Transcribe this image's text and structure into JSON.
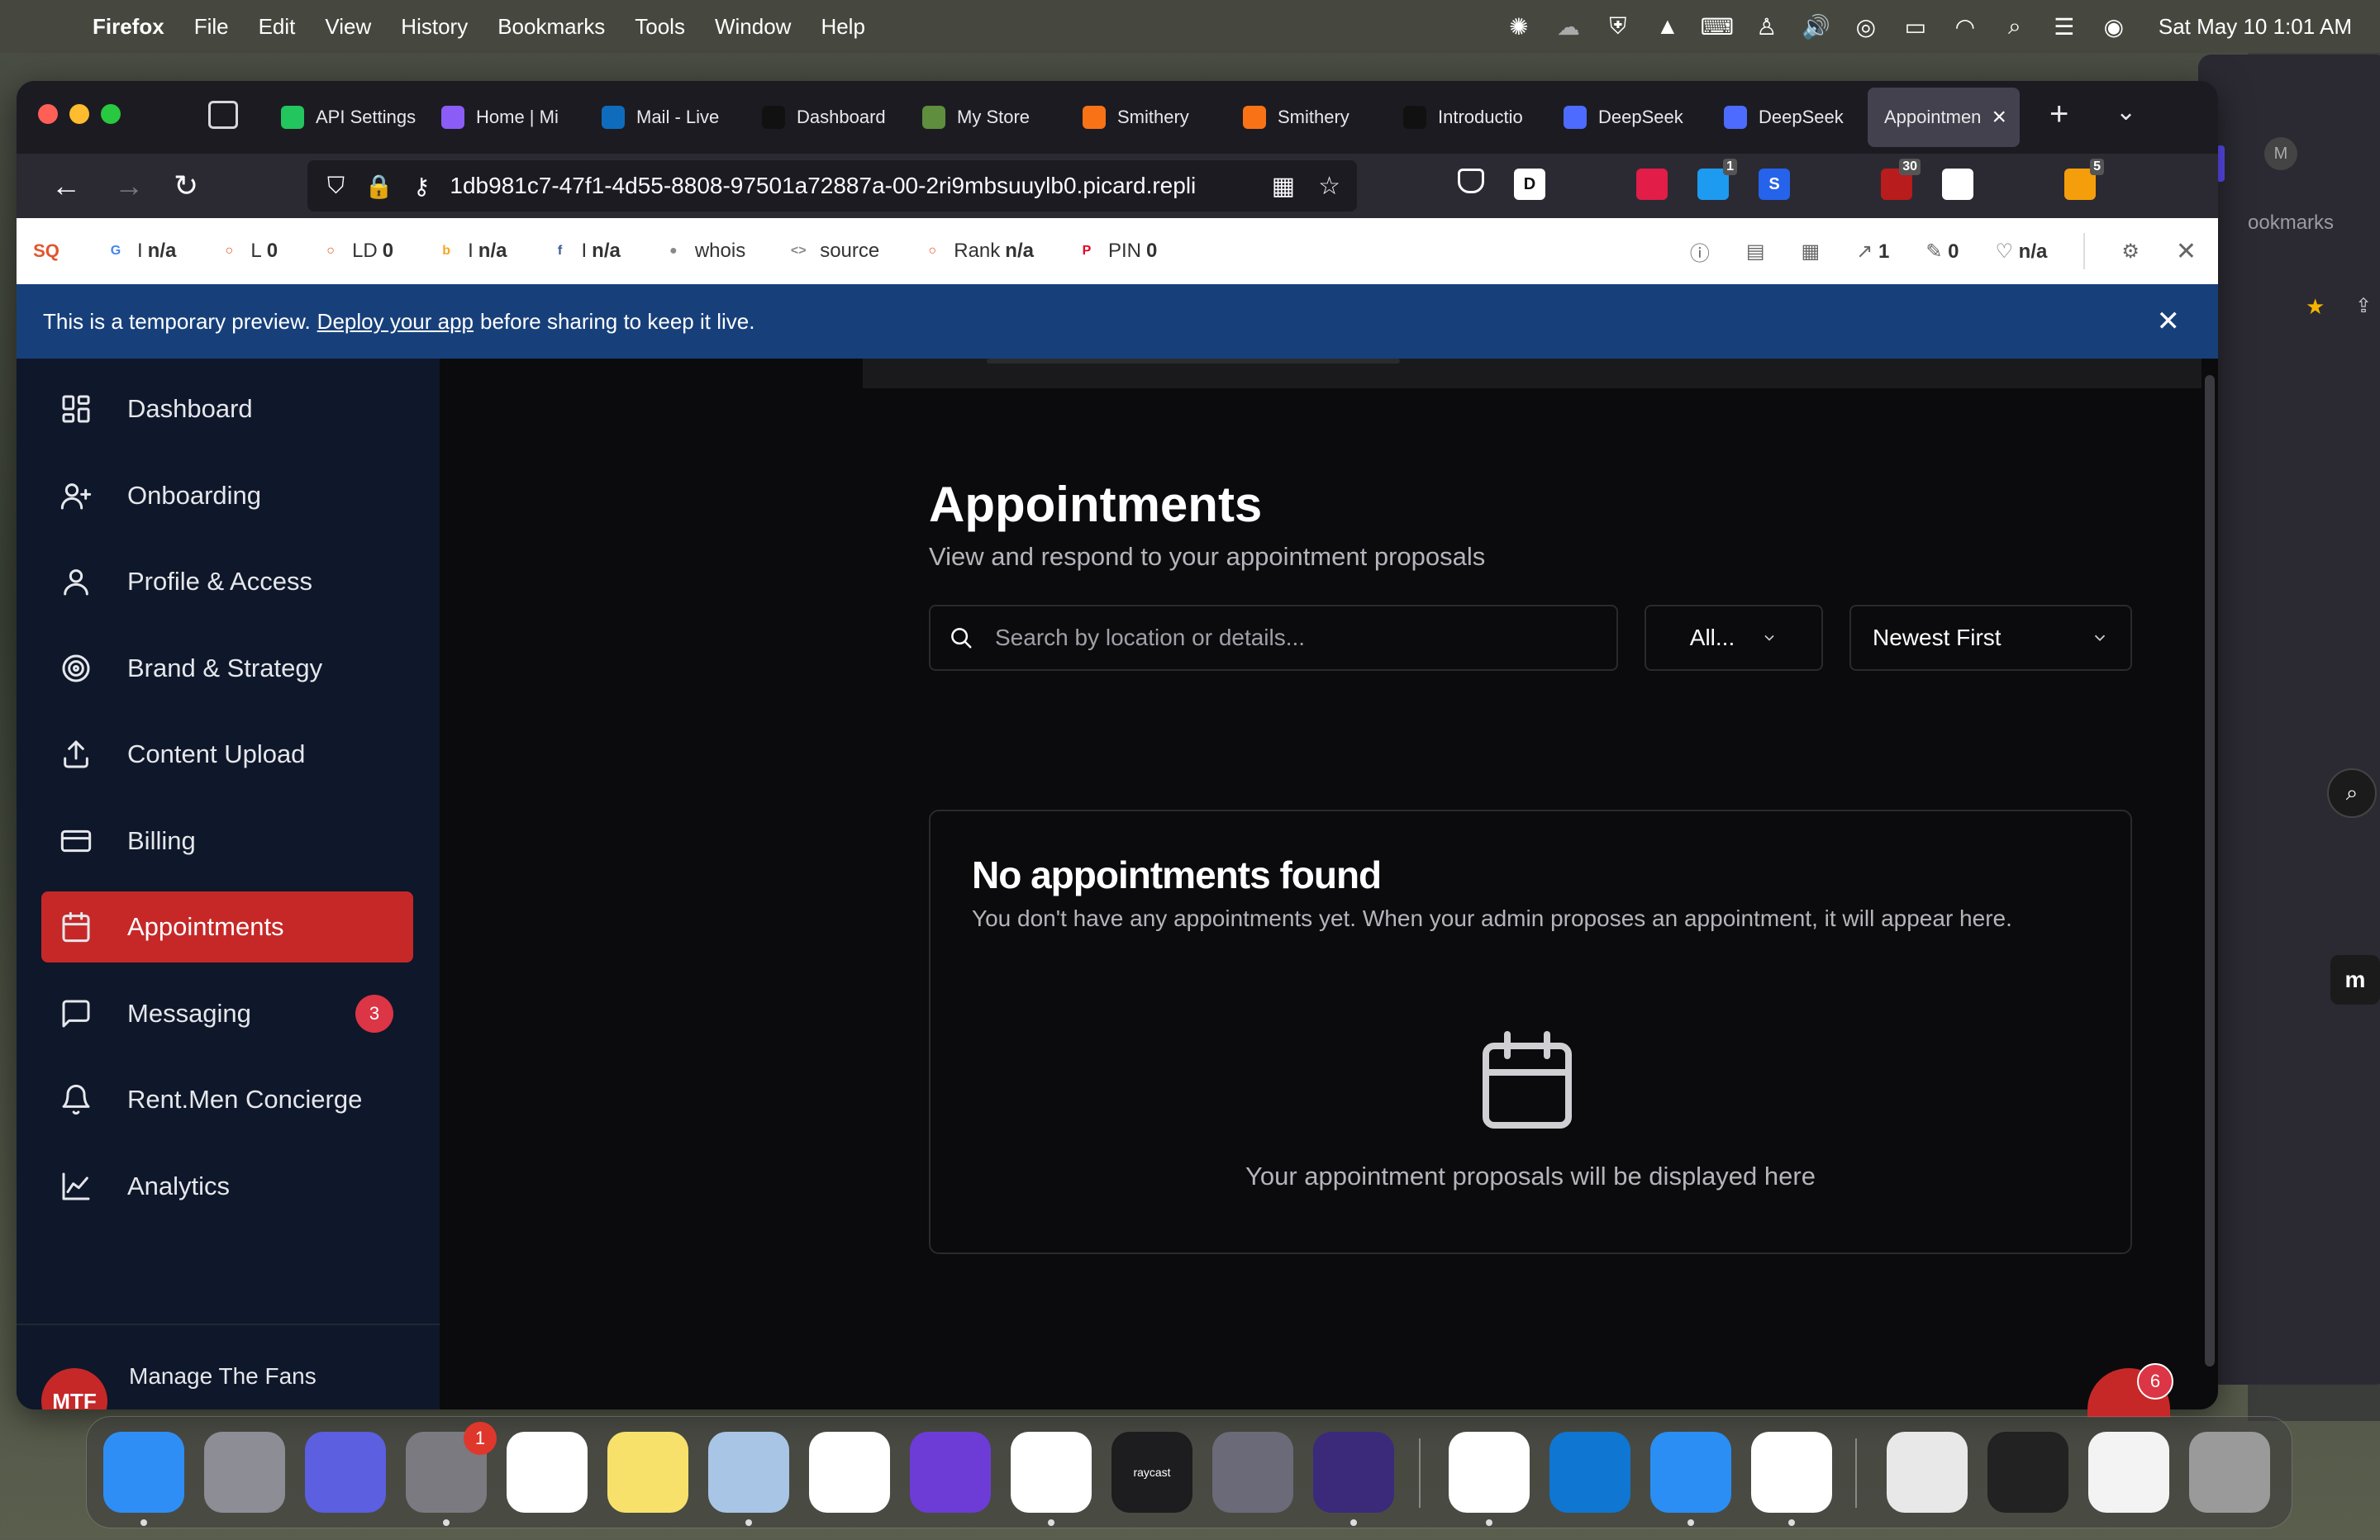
{
  "menubar": {
    "app_name": "Firefox",
    "items": [
      "File",
      "Edit",
      "View",
      "History",
      "Bookmarks",
      "Tools",
      "Window",
      "Help"
    ],
    "clock": "Sat May 10  1:01 AM"
  },
  "tabs": [
    {
      "label": "API Settings",
      "icon_color": "#22c55e",
      "icon": "bolt-icon"
    },
    {
      "label": "Home | Mi",
      "icon_color": "#8b5cf6",
      "icon": "copilot-icon"
    },
    {
      "label": "Mail - Live",
      "icon_color": "#0f6cbd",
      "icon": "outlook-icon"
    },
    {
      "label": "Dashboard",
      "icon_color": "#111111",
      "icon": "chart-icon"
    },
    {
      "label": "My Store",
      "icon_color": "#5e8e3e",
      "icon": "shopify-icon"
    },
    {
      "label": "Smithery",
      "icon_color": "#f97316",
      "icon": "smithery-icon"
    },
    {
      "label": "Smithery",
      "icon_color": "#f97316",
      "icon": "smithery-icon"
    },
    {
      "label": "Introductio",
      "icon_color": "#111111",
      "icon": "diamond-icon"
    },
    {
      "label": "DeepSeek",
      "icon_color": "#4d6bfe",
      "icon": "deepseek-icon"
    },
    {
      "label": "DeepSeek",
      "icon_color": "#4d6bfe",
      "icon": "deepseek-icon"
    },
    {
      "label": "Appointmen",
      "icon_color": "",
      "icon": "",
      "active": true
    }
  ],
  "url": "1db981c7-47f1-4d55-8808-97501a72887a-00-2ri9mbsuuylb0.picard.repli",
  "extensions": [
    {
      "label": "D",
      "color": "#ffffff",
      "text_color": "#111"
    },
    {
      "label": "",
      "color": "transparent"
    },
    {
      "label": "",
      "color": "#e11d48"
    },
    {
      "label": "1",
      "color": "#1d9bf0"
    },
    {
      "label": "S",
      "color": "#2563eb"
    },
    {
      "label": "",
      "color": "transparent"
    },
    {
      "label": "30",
      "color": "#b91c1c"
    },
    {
      "label": "",
      "color": "#ffffff"
    },
    {
      "label": "",
      "color": "transparent"
    },
    {
      "label": "5",
      "color": "#f59e0b"
    }
  ],
  "seobar": {
    "items": [
      {
        "prefix": "I",
        "value": "n/a",
        "icon_color": "#4285f4",
        "icon": "G"
      },
      {
        "prefix": "L",
        "value": "0",
        "icon_color": "#e2552c",
        "icon": "○"
      },
      {
        "prefix": "LD",
        "value": "0",
        "icon_color": "#e2552c",
        "icon": "○"
      },
      {
        "prefix": "I",
        "value": "n/a",
        "icon_color": "#f5a623",
        "icon": "b"
      },
      {
        "prefix": "I",
        "value": "n/a",
        "icon_color": "#3b5998",
        "icon": "f"
      },
      {
        "prefix": "whois",
        "value": "",
        "icon_color": "#888888",
        "icon": "●"
      },
      {
        "prefix": "source",
        "value": "",
        "icon_color": "#888888",
        "icon": "<>"
      },
      {
        "prefix": "Rank",
        "value": "n/a",
        "icon_color": "#e2552c",
        "icon": "○"
      },
      {
        "prefix": "PIN",
        "value": "0",
        "icon_color": "#e60023",
        "icon": "P"
      }
    ],
    "right": {
      "links": "1",
      "edits": "0",
      "score": "n/a"
    }
  },
  "banner": {
    "before": "This is a temporary preview.",
    "link": "Deploy your app",
    "after": "before sharing to keep it live."
  },
  "sidebar": {
    "items": [
      {
        "label": "Dashboard",
        "icon": "dashboard-icon"
      },
      {
        "label": "Onboarding",
        "icon": "user-plus-icon"
      },
      {
        "label": "Profile & Access",
        "icon": "user-icon"
      },
      {
        "label": "Brand & Strategy",
        "icon": "target-icon"
      },
      {
        "label": "Content Upload",
        "icon": "upload-icon"
      },
      {
        "label": "Billing",
        "icon": "card-icon"
      },
      {
        "label": "Appointments",
        "icon": "calendar-icon",
        "active": true
      },
      {
        "label": "Messaging",
        "icon": "message-icon",
        "badge": "3"
      },
      {
        "label": "Rent.Men Concierge",
        "icon": "bell-icon"
      },
      {
        "label": "Analytics",
        "icon": "chart-icon"
      }
    ],
    "footer": {
      "avatar": "MTF",
      "name": "Manage The Fans"
    }
  },
  "main": {
    "title": "Appointments",
    "subtitle": "View and respond to your appointment proposals",
    "search_placeholder": "Search by location or details...",
    "filter_value": "All...",
    "sort_value": "Newest First",
    "empty": {
      "title": "No appointments found",
      "description": "You don't have any appointments yet. When your admin proposes an appointment, it will appear here.",
      "hint": "Your appointment proposals will be displayed here"
    },
    "help_badge": "6"
  },
  "side_browser": {
    "bookmarks_label": "ookmarks",
    "avatar": "M"
  },
  "dock": [
    {
      "name": "finder",
      "color": "#2f8ef5",
      "label": ""
    },
    {
      "name": "launchpad",
      "color": "#8d8d96",
      "label": ""
    },
    {
      "name": "linear",
      "color": "#5b5fe0",
      "label": ""
    },
    {
      "name": "system-settings",
      "color": "#7a7a80",
      "label": "",
      "badge": "1"
    },
    {
      "name": "opera",
      "color": "#ffffff",
      "label": ""
    },
    {
      "name": "notes",
      "color": "#f8e16a",
      "label": ""
    },
    {
      "name": "preview",
      "color": "#a8c5e6",
      "label": ""
    },
    {
      "name": "chrome",
      "color": "#ffffff",
      "label": ""
    },
    {
      "name": "shortcuts",
      "color": "#6d3cd6",
      "label": ""
    },
    {
      "name": "photos",
      "color": "#ffffff",
      "label": ""
    },
    {
      "name": "raycast",
      "color": "#1d1d1f",
      "label": "raycast"
    },
    {
      "name": "affinity",
      "color": "#6a6a78",
      "label": ""
    },
    {
      "name": "firefox",
      "color": "#3b2a7a",
      "label": ""
    },
    {
      "name": "wix",
      "color": "#ffffff",
      "label": ""
    },
    {
      "name": "onedrive",
      "color": "#0f76d1",
      "label": ""
    },
    {
      "name": "safari",
      "color": "#2a8ef5",
      "label": ""
    },
    {
      "name": "vscode",
      "color": "#ffffff",
      "label": ""
    },
    {
      "name": "files",
      "color": "#e8e8e8",
      "label": ""
    },
    {
      "name": "window-1",
      "color": "#222222",
      "label": ""
    },
    {
      "name": "window-2",
      "color": "#f3f3f3",
      "label": ""
    },
    {
      "name": "trash",
      "color": "#9a9a9a",
      "label": ""
    }
  ]
}
